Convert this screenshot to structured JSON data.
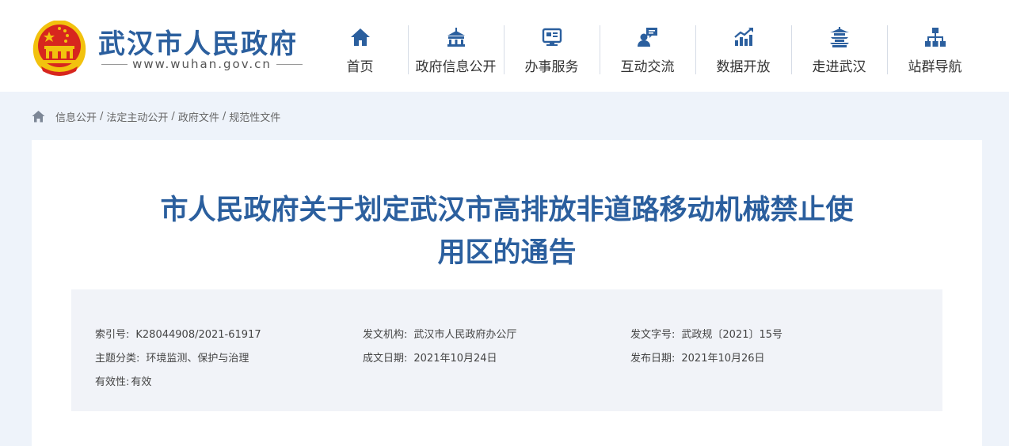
{
  "header": {
    "site_name": "武汉市人民政府",
    "site_url": "www.wuhan.gov.cn",
    "nav": [
      {
        "label": "首页",
        "icon": "home-icon"
      },
      {
        "label": "政府信息公开",
        "icon": "government-building-icon"
      },
      {
        "label": "办事服务",
        "icon": "service-card-icon"
      },
      {
        "label": "互动交流",
        "icon": "chat-user-icon"
      },
      {
        "label": "数据开放",
        "icon": "bar-chart-icon"
      },
      {
        "label": "走进武汉",
        "icon": "pavilion-icon"
      },
      {
        "label": "站群导航",
        "icon": "sitemap-icon"
      }
    ]
  },
  "breadcrumb": [
    "信息公开",
    "法定主动公开",
    "政府文件",
    "规范性文件"
  ],
  "document": {
    "title_line1": "市人民政府关于划定武汉市高排放非道路移动机械禁止使",
    "title_line2": "用区的通告",
    "meta": {
      "index_no": {
        "label": "索引号:",
        "value": "K28044908/2021-61917"
      },
      "issuer": {
        "label": "发文机构:",
        "value": "武汉市人民政府办公厅"
      },
      "doc_no": {
        "label": "发文字号:",
        "value": "武政规〔2021〕15号"
      },
      "topic": {
        "label": "主题分类:",
        "value": "环境监测、保护与治理"
      },
      "written_date": {
        "label": "成文日期:",
        "value": "2021年10月24日"
      },
      "publish_date": {
        "label": "发布日期:",
        "value": "2021年10月26日"
      },
      "validity": {
        "label": "有效性:",
        "value": "有效"
      }
    }
  },
  "colors": {
    "brand_blue": "#2b5f9e",
    "emblem_red": "#d7261e",
    "emblem_gold": "#f2c20e",
    "page_bg": "#eef3fa",
    "meta_bg": "#f1f3f8"
  }
}
